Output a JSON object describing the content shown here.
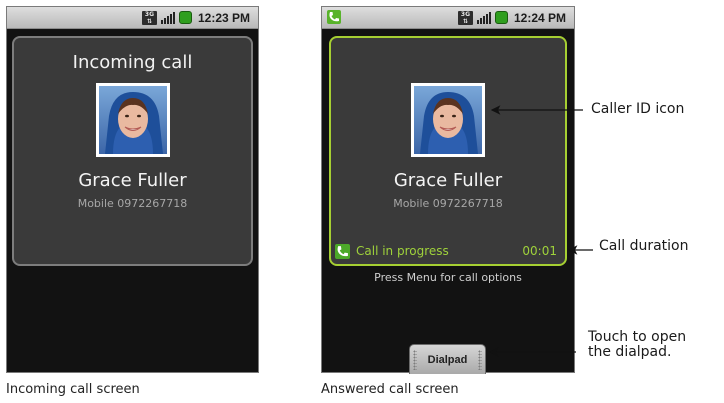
{
  "left_screen": {
    "status_bar": {
      "network": "3G",
      "time": "12:23 PM"
    },
    "title": "Incoming call",
    "caller": {
      "name": "Grace Fuller",
      "number": "Mobile 0972267718"
    },
    "caption": "Incoming call screen"
  },
  "right_screen": {
    "status_bar": {
      "network": "3G",
      "time": "12:24 PM",
      "call_icon": "phone-handset-icon"
    },
    "caller": {
      "name": "Grace Fuller",
      "number": "Mobile 0972267718"
    },
    "call_progress_label": "Call in progress",
    "call_duration": "00:01",
    "menu_hint": "Press Menu for call options",
    "dialpad_label": "Dialpad",
    "caption": "Answered call screen"
  },
  "callouts": {
    "caller_id_icon": "Caller ID icon",
    "call_duration": "Call duration",
    "dialpad_line1": "Touch to open",
    "dialpad_line2": "the dialpad."
  },
  "colors": {
    "accent_green": "#9fd23a",
    "card_border_active": "#a6cf32",
    "screen_background": "#121212"
  }
}
